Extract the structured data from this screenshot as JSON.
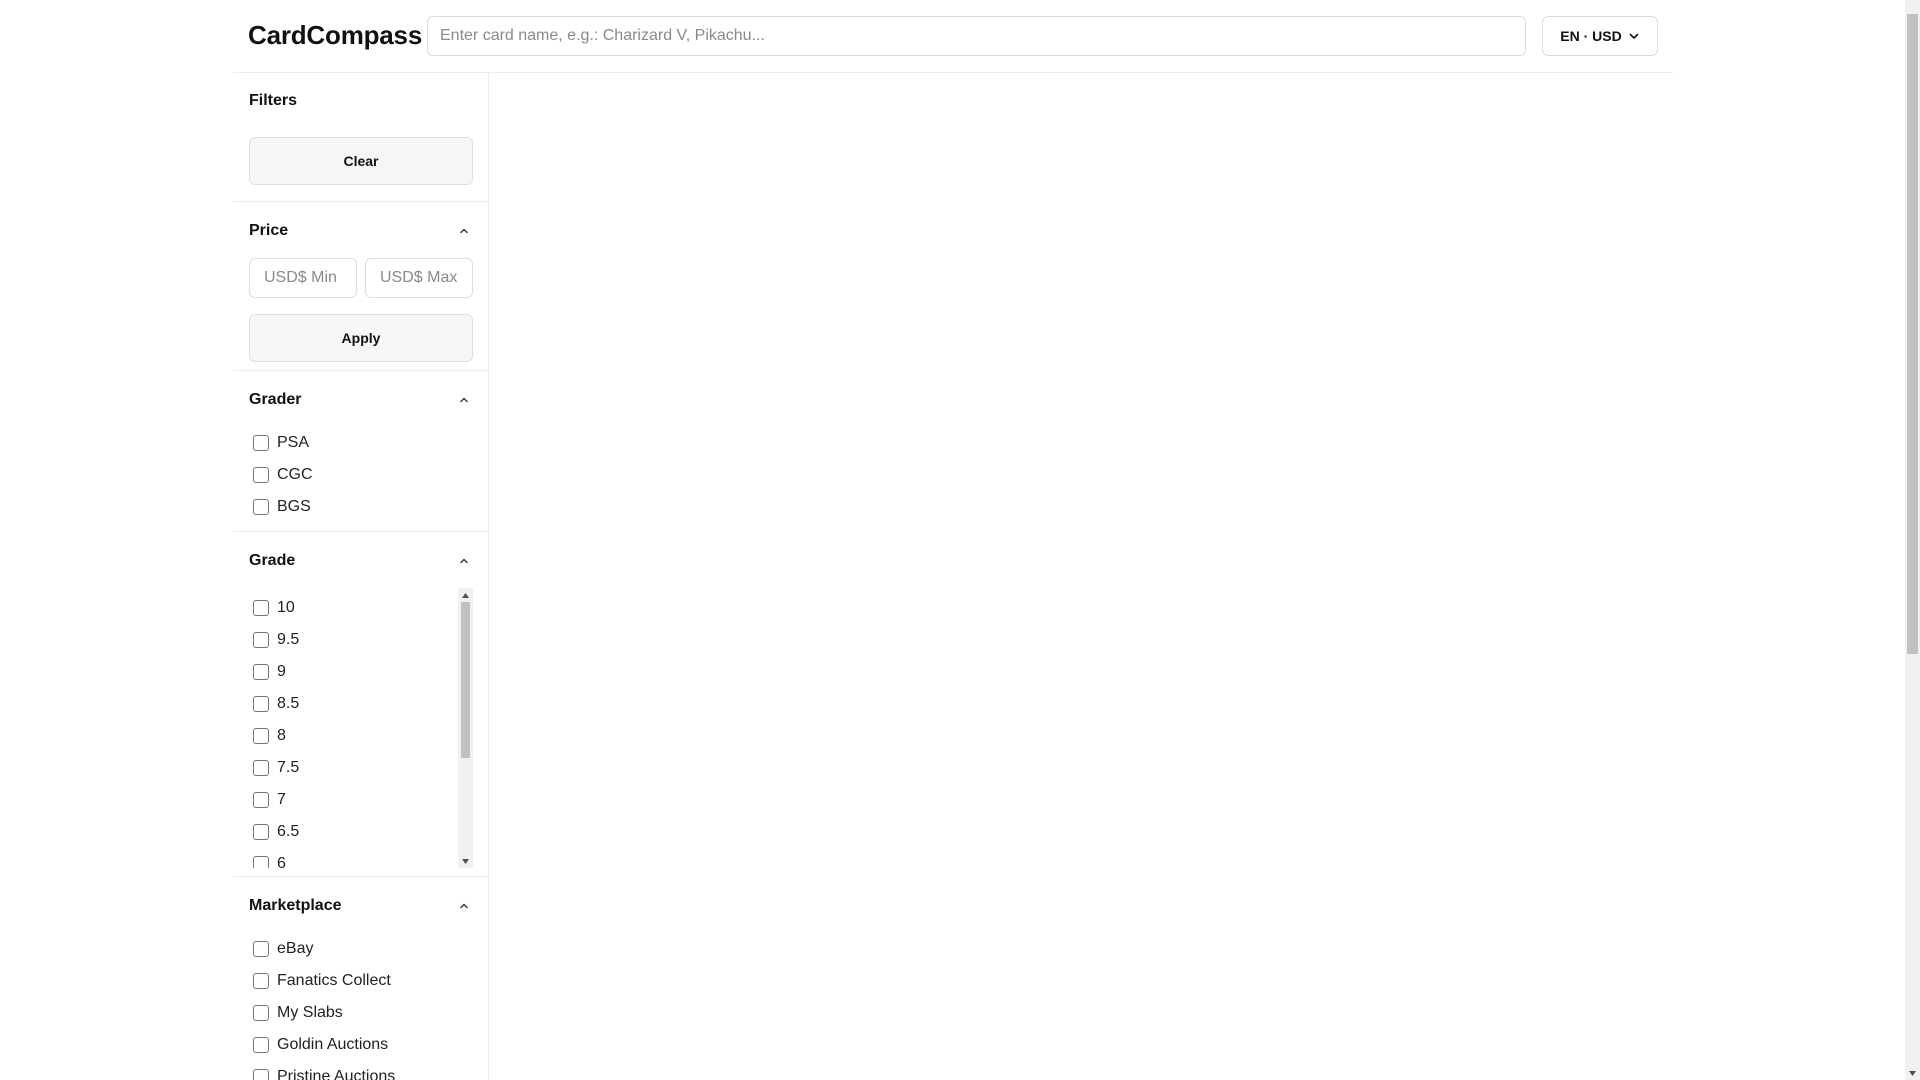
{
  "header": {
    "logo": "CardCompass",
    "search_placeholder": "Enter card name, e.g.: Charizard V, Pikachu...",
    "locale_label": "EN · USD"
  },
  "sidebar": {
    "filters_title": "Filters",
    "clear_label": "Clear",
    "price": {
      "title": "Price",
      "min_placeholder": "USD$ Min",
      "max_placeholder": "USD$ Max",
      "apply_label": "Apply"
    },
    "grader": {
      "title": "Grader",
      "options": [
        "PSA",
        "CGC",
        "BGS"
      ]
    },
    "grade": {
      "title": "Grade",
      "options": [
        "10",
        "9.5",
        "9",
        "8.5",
        "8",
        "7.5",
        "7",
        "6.5",
        "6"
      ]
    },
    "marketplace": {
      "title": "Marketplace",
      "options": [
        "eBay",
        "Fanatics Collect",
        "My Slabs",
        "Goldin Auctions",
        "Pristine Auctions"
      ]
    }
  }
}
